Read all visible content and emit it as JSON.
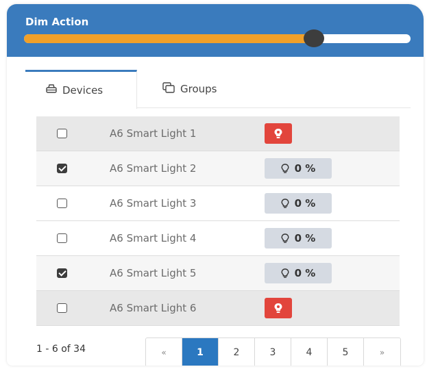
{
  "header": {
    "title": "Dim Action",
    "slider_value_fraction": 0.75,
    "colors": {
      "background": "#3a7bbd",
      "fill": "#f0a02a",
      "thumb": "#3d3d3d"
    }
  },
  "tabs": [
    {
      "label": "Devices",
      "icon": "printer-icon",
      "active": true
    },
    {
      "label": "Groups",
      "icon": "copy-icon",
      "active": false
    }
  ],
  "devices": [
    {
      "name": "A6 Smart Light 1",
      "checked": false,
      "status": "alert",
      "level": ""
    },
    {
      "name": "A6 Smart Light 2",
      "checked": true,
      "status": "level",
      "level": "0 %"
    },
    {
      "name": "A6 Smart Light 3",
      "checked": false,
      "status": "level",
      "level": "0 %"
    },
    {
      "name": "A6 Smart Light 4",
      "checked": false,
      "status": "level",
      "level": "0 %"
    },
    {
      "name": "A6 Smart Light 5",
      "checked": true,
      "status": "level",
      "level": "0 %"
    },
    {
      "name": "A6 Smart Light 6",
      "checked": false,
      "status": "alert",
      "level": ""
    }
  ],
  "pagination": {
    "range_text": "1 - 6 of 34",
    "prev": "«",
    "next": "»",
    "pages": [
      "1",
      "2",
      "3",
      "4",
      "5"
    ],
    "current": "1"
  },
  "colors": {
    "alert": "#e2453c",
    "level_badge": "#d5dae2",
    "active_page": "#2b78c0"
  }
}
